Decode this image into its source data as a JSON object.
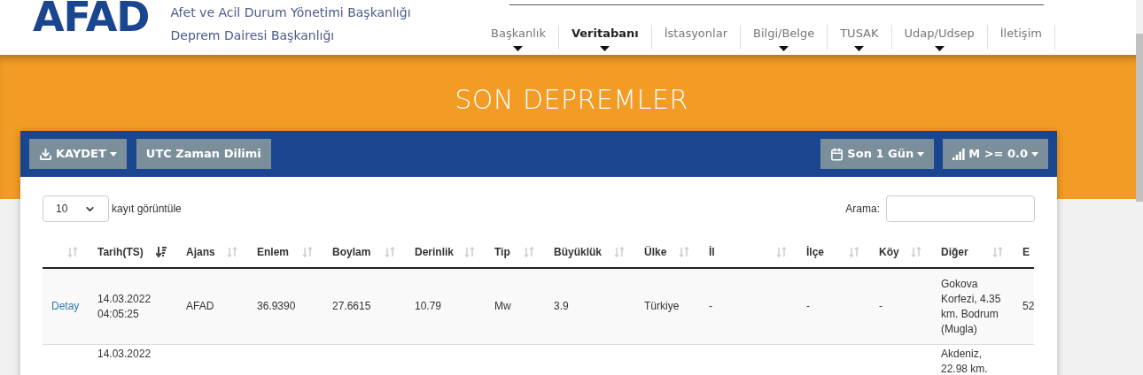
{
  "header": {
    "logo": "AFAD",
    "org_lines": [
      "Afet ve Acil Durum Yönetimi Başkanlığı",
      "Deprem Dairesi Başkanlığı"
    ]
  },
  "nav": [
    {
      "label": "Başkanlık",
      "selected": false,
      "has_menu": true
    },
    {
      "label": "Veritabanı",
      "selected": true,
      "has_menu": true
    },
    {
      "label": "İstasyonlar",
      "selected": false,
      "has_menu": false
    },
    {
      "label": "Bilgi/Belge",
      "selected": false,
      "has_menu": true
    },
    {
      "label": "TUSAK",
      "selected": false,
      "has_menu": true
    },
    {
      "label": "Udap/Udsep",
      "selected": false,
      "has_menu": true
    },
    {
      "label": "İletişim",
      "selected": false,
      "has_menu": false
    }
  ],
  "page_title": "SON DEPREMLER",
  "toolbar": {
    "left": [
      {
        "kind": "download",
        "label": "KAYDET",
        "caret": true
      },
      {
        "kind": "plain",
        "label": "UTC Zaman Dilimi",
        "caret": false
      }
    ],
    "right": [
      {
        "kind": "calendar",
        "label": "Son 1 Gün",
        "caret": true
      },
      {
        "kind": "signal",
        "label": "M >= 0.0",
        "caret": true
      }
    ]
  },
  "length_select": {
    "value": "10",
    "label": "kayıt görüntüle"
  },
  "search": {
    "label": "Arama:"
  },
  "table": {
    "columns": [
      {
        "sorted": false
      },
      {
        "label": "Tarih(TS)",
        "sorted": true
      },
      {
        "label": "Ajans",
        "sorted": false
      },
      {
        "label": "Enlem",
        "sorted": false
      },
      {
        "label": "Boylam",
        "sorted": false
      },
      {
        "label": "Derinlik",
        "sorted": false
      },
      {
        "label": "Tip",
        "sorted": false
      },
      {
        "label": "Büyüklük",
        "sorted": false
      },
      {
        "label": "Ülke",
        "sorted": false
      },
      {
        "label": "İl",
        "sorted": false
      },
      {
        "label": "İlçe",
        "sorted": false
      },
      {
        "label": "Köy",
        "sorted": false
      },
      {
        "label": "Diğer",
        "sorted": false
      },
      {
        "label": "E"
      }
    ],
    "rows": [
      {
        "cells": [
          "Detay",
          "14.03.2022 04:05:25",
          "AFAD",
          "36.9390",
          "27.6615",
          "10.79",
          "Mw",
          "3.9",
          "Türkiye",
          "-",
          "-",
          "-",
          "Gokova Korfezi, 4.35 km. Bodrum (Mugla)",
          "52"
        ]
      },
      {
        "cells": [
          "",
          "14.03.2022",
          "",
          "",
          "",
          "",
          "",
          "",
          "",
          "",
          "",
          "",
          "Akdeniz, 22.98 km.",
          ""
        ]
      }
    ]
  }
}
